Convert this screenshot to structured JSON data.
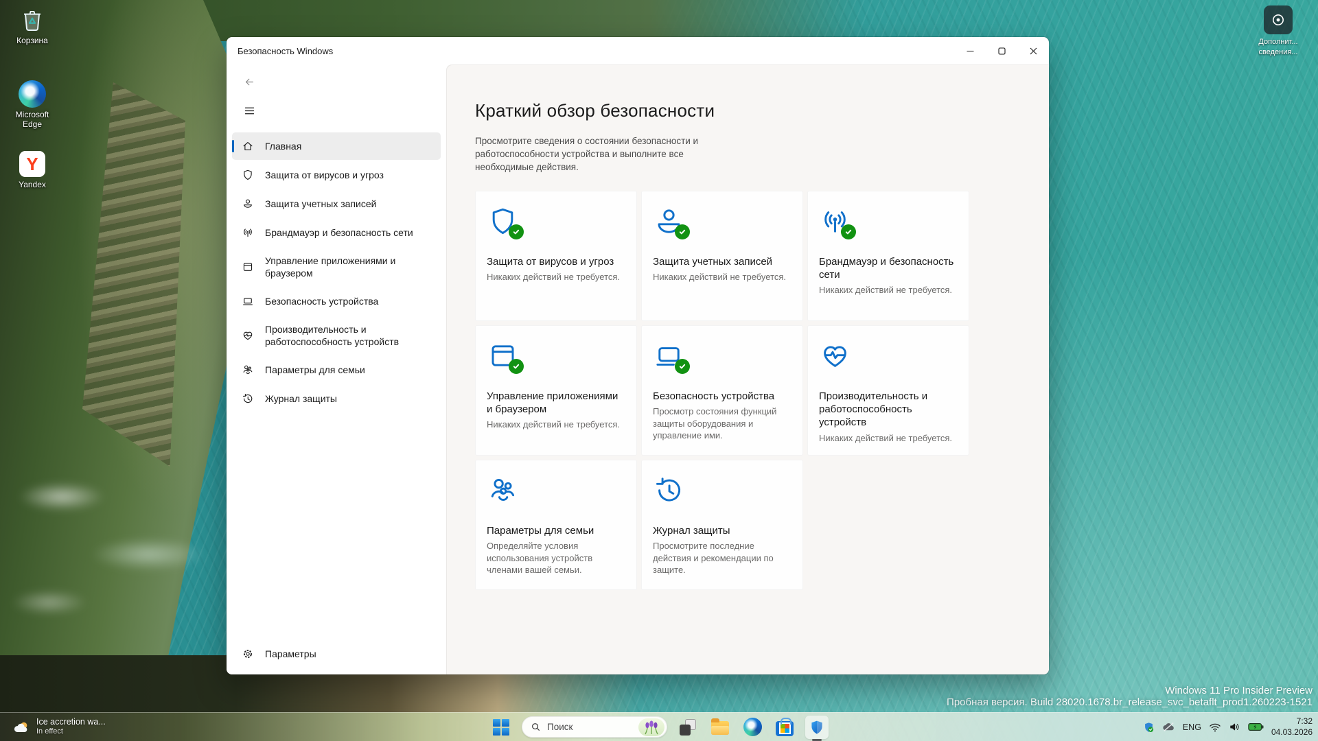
{
  "desktop": {
    "icons": [
      {
        "label": "Корзина",
        "icon": "recycle-bin"
      },
      {
        "label": "Microsoft Edge",
        "icon": "edge-browser"
      },
      {
        "label": "Yandex",
        "icon": "yandex-browser"
      }
    ],
    "spotlight_label_1": "Дополнит...",
    "spotlight_label_2": "сведения...",
    "watermark_line_1": "Windows 11 Pro Insider Preview",
    "watermark_line_2": "Пробная версия. Build 28020.1678.br_release_svc_betaflt_prod1.260223-1521"
  },
  "app": {
    "title": "Безопасность Windows",
    "nav": {
      "items": [
        {
          "label": "Главная",
          "icon": "home",
          "selected": true
        },
        {
          "label": "Защита от вирусов и угроз",
          "icon": "shield"
        },
        {
          "label": "Защита учетных записей",
          "icon": "person"
        },
        {
          "label": "Брандмауэр и безопасность сети",
          "icon": "network"
        },
        {
          "label": "Управление приложениями и браузером",
          "icon": "app-window"
        },
        {
          "label": "Безопасность устройства",
          "icon": "laptop"
        },
        {
          "label": "Производительность и работоспособность устройств",
          "icon": "heart-pulse"
        },
        {
          "label": "Параметры для семьи",
          "icon": "family"
        },
        {
          "label": "Журнал защиты",
          "icon": "history"
        }
      ],
      "settings": "Параметры"
    },
    "main": {
      "title": "Краткий обзор безопасности",
      "subtitle": "Просмотрите сведения о состоянии безопасности и работоспособности устройства и выполните все необходимые действия.",
      "cards": [
        {
          "title": "Защита от вирусов и угроз",
          "desc": "Никаких действий не требуется.",
          "icon": "shield",
          "status_ok": true
        },
        {
          "title": "Защита учетных записей",
          "desc": "Никаких действий не требуется.",
          "icon": "person",
          "status_ok": true
        },
        {
          "title": "Брандмауэр и безопасность сети",
          "desc": "Никаких действий не требуется.",
          "icon": "network",
          "status_ok": true
        },
        {
          "title": "Управление приложениями и браузером",
          "desc": "Никаких действий не требуется.",
          "icon": "app-window",
          "status_ok": true
        },
        {
          "title": "Безопасность устройства",
          "desc": "Просмотр состояния функций защиты оборудования и управление ими.",
          "icon": "laptop",
          "status_ok": true
        },
        {
          "title": "Производительность и работоспособность устройств",
          "desc": "Никаких действий не требуется.",
          "icon": "heart-pulse",
          "status_ok": false
        },
        {
          "title": "Параметры для семьи",
          "desc": "Определяйте условия использования устройств членами вашей семьи.",
          "icon": "family",
          "status_ok": false
        },
        {
          "title": "Журнал защиты",
          "desc": "Просмотрите последние действия и рекомендации по защите.",
          "icon": "history",
          "status_ok": false
        }
      ]
    }
  },
  "taskbar": {
    "widgets_line_1": "Ice accretion wa...",
    "widgets_line_2": "In effect",
    "search_placeholder": "Поиск",
    "tray": {
      "lang": "ENG",
      "time": "7:32",
      "date": "04.03.2026"
    }
  },
  "colors": {
    "accent": "#0067c0",
    "icon_blue": "#1070ca",
    "status_green": "#129212",
    "ocean_teal": "#2d9596"
  }
}
